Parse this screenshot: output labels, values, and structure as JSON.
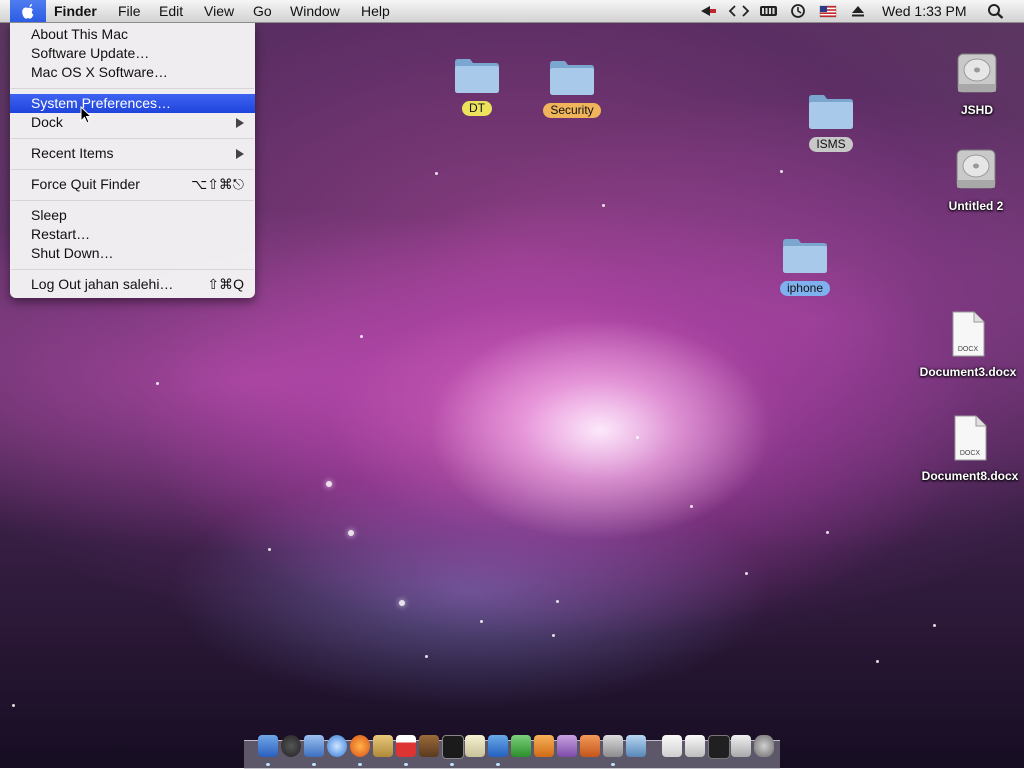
{
  "menubar": {
    "apple_icon": "apple-icon",
    "app_name": "Finder",
    "menus": [
      "File",
      "Edit",
      "View",
      "Go",
      "Window",
      "Help"
    ],
    "status": {
      "clock": "Wed 1:33 PM",
      "icons": [
        "bluetooth-icon",
        "remote-desktop-icon",
        "battery-icon",
        "time-machine-icon",
        "us-flag-input-icon",
        "eject-icon",
        "spotlight-icon"
      ]
    }
  },
  "apple_menu": {
    "items": [
      {
        "label": "About This Mac",
        "shortcut": ""
      },
      {
        "label": "Software Update…",
        "shortcut": ""
      },
      {
        "label": "Mac OS X Software…",
        "shortcut": ""
      },
      {
        "label": "System Preferences…",
        "shortcut": "",
        "selected": true
      },
      {
        "label": "Dock",
        "shortcut": "",
        "submenu": true
      },
      {
        "label": "Recent Items",
        "shortcut": "",
        "submenu": true
      },
      {
        "label": "Force Quit Finder",
        "shortcut": "⌥⇧⌘⎋"
      },
      {
        "label": "Sleep",
        "shortcut": ""
      },
      {
        "label": "Restart…",
        "shortcut": ""
      },
      {
        "label": "Shut Down…",
        "shortcut": ""
      },
      {
        "label": "Log Out jahan salehi…",
        "shortcut": "⇧⌘Q"
      }
    ]
  },
  "desktop": {
    "icons": [
      {
        "name": "DT",
        "type": "folder",
        "label_color": "yellow"
      },
      {
        "name": "Security",
        "type": "folder",
        "label_color": "orange"
      },
      {
        "name": "ISMS",
        "type": "folder",
        "label_color": "gray"
      },
      {
        "name": "iphone",
        "type": "folder",
        "label_color": "blue"
      },
      {
        "name": "JSHD",
        "type": "hard-drive",
        "label_color": "none"
      },
      {
        "name": "Untitled 2",
        "type": "hard-drive",
        "label_color": "none"
      },
      {
        "name": "Document3.docx",
        "type": "docx",
        "label_color": "none",
        "badge": "DOCX"
      },
      {
        "name": "Document8.docx",
        "type": "docx",
        "label_color": "none",
        "badge": "DOCX"
      }
    ]
  },
  "colors": {
    "menu_highlight": "#2f55e6",
    "folder_blue": "#8fb8dd"
  }
}
